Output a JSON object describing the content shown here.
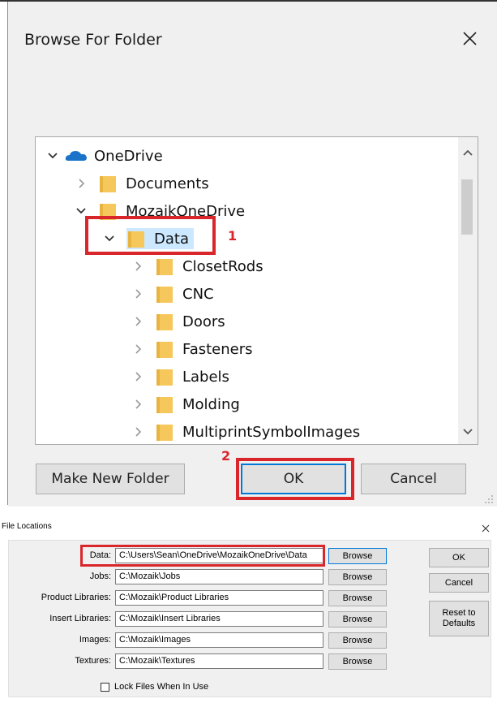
{
  "browse_dialog": {
    "title": "Browse For Folder",
    "tree": [
      {
        "label": "OneDrive",
        "icon": "cloud-icon",
        "expanded": true
      },
      {
        "label": "Documents",
        "icon": "folder-icon",
        "expanded": false
      },
      {
        "label": "MozaikOneDrive",
        "icon": "folder-icon",
        "expanded": true
      },
      {
        "label": "Data",
        "icon": "folder-open-icon",
        "expanded": true,
        "selected": true
      },
      {
        "label": "ClosetRods",
        "icon": "folder-icon",
        "expanded": false
      },
      {
        "label": "CNC",
        "icon": "folder-icon",
        "expanded": false
      },
      {
        "label": "Doors",
        "icon": "folder-icon",
        "expanded": false
      },
      {
        "label": "Fasteners",
        "icon": "folder-icon",
        "expanded": false
      },
      {
        "label": "Labels",
        "icon": "folder-icon",
        "expanded": false
      },
      {
        "label": "Molding",
        "icon": "folder-icon",
        "expanded": false
      },
      {
        "label": "MultiprintSymbolImages",
        "icon": "folder-icon",
        "expanded": false
      }
    ],
    "buttons": {
      "make_new_folder": "Make New Folder",
      "ok": "OK",
      "cancel": "Cancel"
    },
    "annotations": {
      "step1": "1",
      "step2": "2"
    }
  },
  "file_locations": {
    "title": "File Locations",
    "rows": [
      {
        "label": "Data:",
        "value": "C:\\Users\\Sean\\OneDrive\\MozaikOneDrive\\Data",
        "button": "Browse"
      },
      {
        "label": "Jobs:",
        "value": "C:\\Mozaik\\Jobs",
        "button": "Browse"
      },
      {
        "label": "Product Libraries:",
        "value": "C:\\Mozaik\\Product Libraries",
        "button": "Browse"
      },
      {
        "label": "Insert Libraries:",
        "value": "C:\\Mozaik\\Insert Libraries",
        "button": "Browse"
      },
      {
        "label": "Images:",
        "value": "C:\\Mozaik\\Images",
        "button": "Browse"
      },
      {
        "label": "Textures:",
        "value": "C:\\Mozaik\\Textures",
        "button": "Browse"
      }
    ],
    "buttons": {
      "ok": "OK",
      "cancel": "Cancel",
      "reset": "Reset to Defaults"
    },
    "lock_files_label": "Lock Files When In Use",
    "lock_files_checked": false
  },
  "colors": {
    "annotation_red": "#d9262b",
    "folder_yellow": "#f6c85c",
    "onedrive_blue": "#1a73c9",
    "selection_blue": "#cce8ff"
  }
}
